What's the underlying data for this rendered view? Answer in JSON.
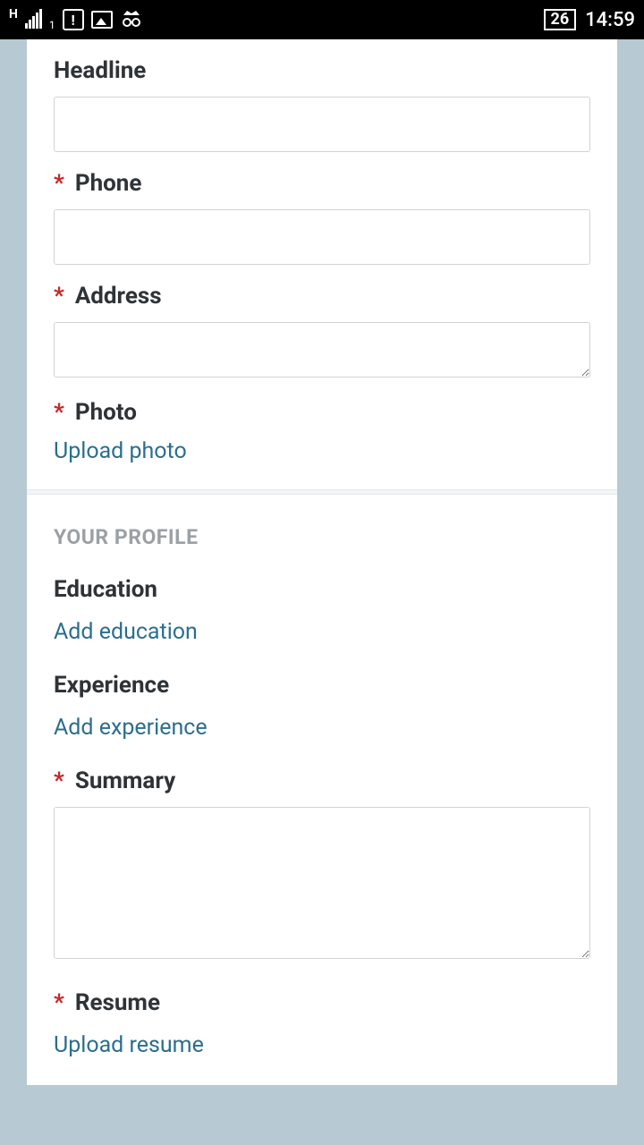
{
  "status": {
    "network_type": "H",
    "sim_slot": "1",
    "battery": "26",
    "time": "14:59"
  },
  "form": {
    "headline": {
      "label": "Headline",
      "required": false,
      "value": ""
    },
    "phone": {
      "label": "Phone",
      "required": true,
      "value": ""
    },
    "address": {
      "label": "Address",
      "required": true,
      "value": ""
    },
    "photo": {
      "label": "Photo",
      "required": true,
      "action": "Upload photo"
    }
  },
  "profile": {
    "heading": "YOUR PROFILE",
    "education": {
      "label": "Education",
      "action": "Add education"
    },
    "experience": {
      "label": "Experience",
      "action": "Add experience"
    },
    "summary": {
      "label": "Summary",
      "required": true,
      "value": ""
    },
    "resume": {
      "label": "Resume",
      "required": true,
      "action": "Upload resume"
    }
  },
  "required_marker": "*"
}
